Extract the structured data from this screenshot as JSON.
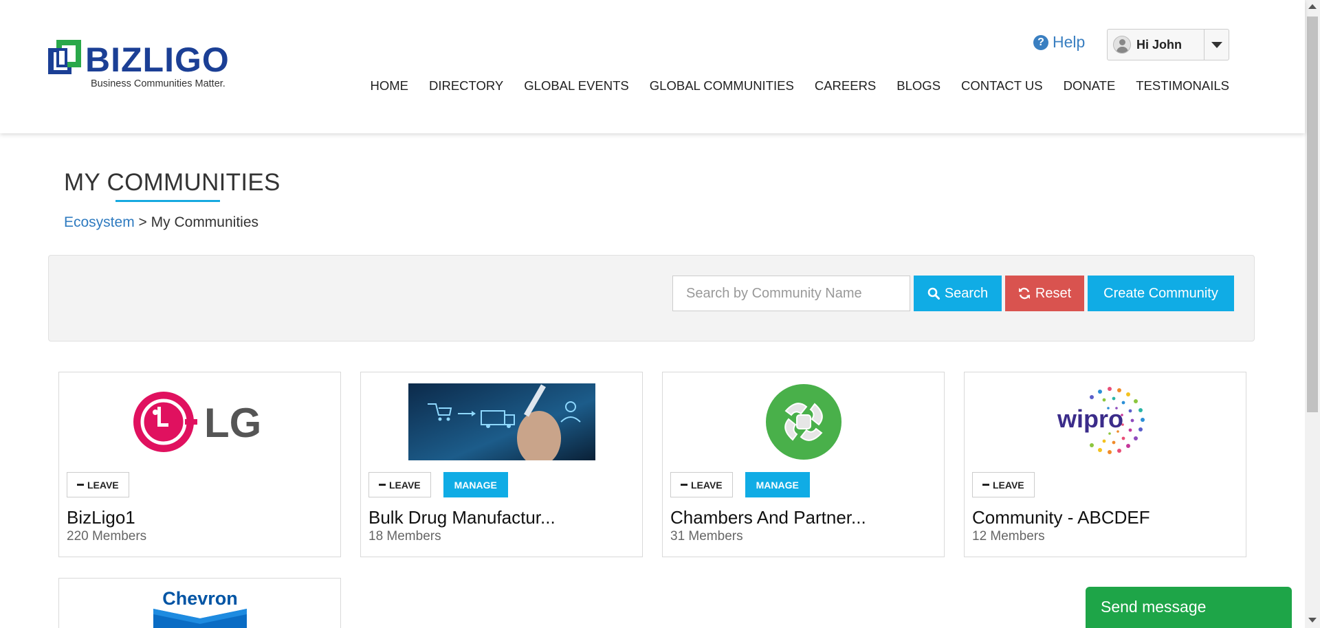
{
  "brand": {
    "name": "BIZLIGO",
    "tagline": "Business Communities Matter."
  },
  "header": {
    "help_label": "Help",
    "user_greeting": "Hi John",
    "nav": [
      "HOME",
      "DIRECTORY",
      "GLOBAL EVENTS",
      "GLOBAL COMMUNITIES",
      "CAREERS",
      "BLOGS",
      "CONTACT US",
      "DONATE",
      "TESTIMONAILS"
    ]
  },
  "page": {
    "title": "MY COMMUNITIES",
    "breadcrumb": {
      "link": "Ecosystem",
      "separator": " > ",
      "current": "My Communities"
    }
  },
  "search": {
    "placeholder": "Search by Community Name",
    "value": "",
    "search_label": "Search",
    "reset_label": "Reset",
    "create_label": "Create Community"
  },
  "communities": [
    {
      "name": "BizLigo1",
      "members": "220 Members",
      "logo": "lg-logo",
      "leave_label": "LEAVE",
      "manage_label": ""
    },
    {
      "name": "Bulk Drug Manufactur...",
      "members": "18 Members",
      "logo": "business-process-image",
      "leave_label": "LEAVE",
      "manage_label": "MANAGE"
    },
    {
      "name": "Chambers And Partner...",
      "members": "31 Members",
      "logo": "handshake-circle-logo",
      "leave_label": "LEAVE",
      "manage_label": "MANAGE"
    },
    {
      "name": "Community - ABCDEF",
      "members": "12 Members",
      "logo": "wipro-logo",
      "leave_label": "LEAVE",
      "manage_label": ""
    },
    {
      "name": "",
      "members": "",
      "logo": "chevron-logo",
      "leave_label": "",
      "manage_label": ""
    }
  ],
  "logo_text": {
    "lg": "LG",
    "wipro": "wipro",
    "chevron": "Chevron"
  },
  "chat": {
    "send_message_label": "Send message"
  },
  "colors": {
    "brand_blue": "#1b3f95",
    "brand_green": "#1ea548",
    "accent": "#10ace5",
    "danger": "#d9534f",
    "link": "#2f7bc0"
  }
}
